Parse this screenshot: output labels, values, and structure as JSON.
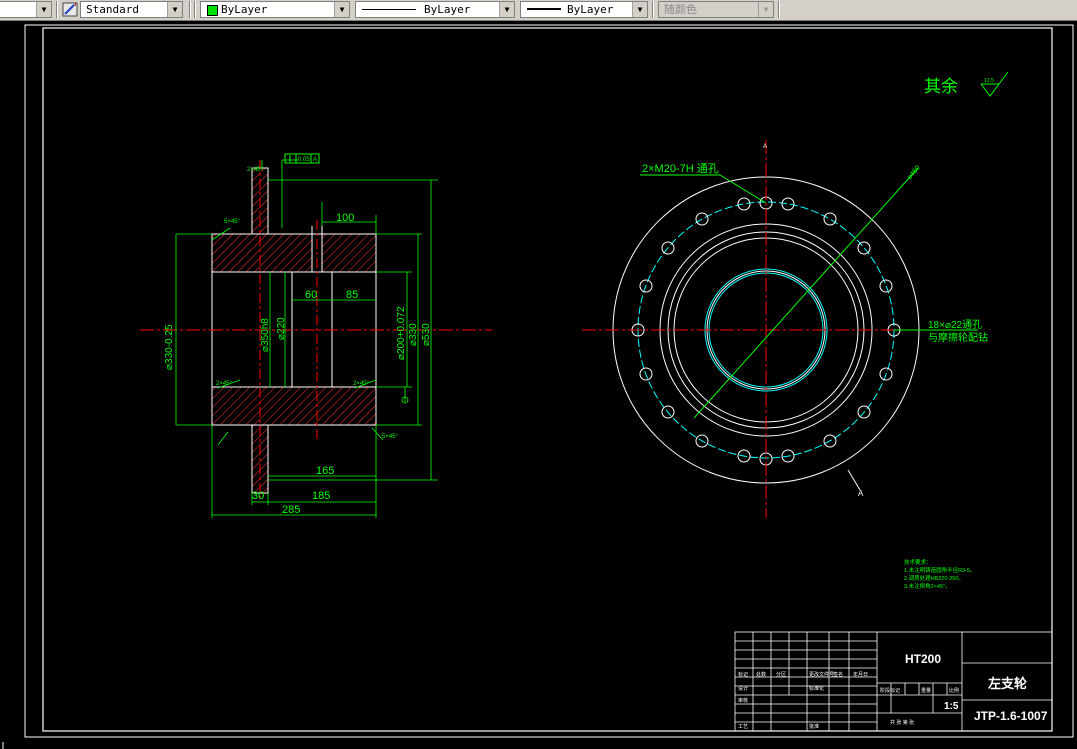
{
  "toolbar": {
    "textstyle": "Standard",
    "layer": "ByLayer",
    "linetype": "ByLayer",
    "lineweight": "ByLayer",
    "plotstyle": "随颜色"
  },
  "icons": {
    "textstyle": "text-style-icon"
  },
  "colors": {
    "background": "#000000",
    "outline": "#ffffff",
    "dimension": "#00ff00",
    "centerline": "#ff0000",
    "hidden": "#00ffff",
    "hatch": "#ff3333"
  },
  "drawing": {
    "roughness": "其余",
    "roughness_value": "12.5",
    "dims": {
      "d100": "100",
      "d60": "60",
      "d85": "85",
      "d165": "165",
      "d185": "185",
      "d30": "30",
      "d285": "285",
      "dia330tol": "⌀330-0.25",
      "dia350": "⌀350h8",
      "dia220": "⌀220",
      "dia200": "⌀200+0.072",
      "dia330": "⌀330",
      "dia530": "⌀530",
      "dia450": "⌀450",
      "chamfer": "2×45°",
      "chamfer2": "5×45°",
      "tol_frame": "0.05",
      "datum": "A",
      "section": "A"
    },
    "callouts": {
      "thread": "2×M20-7H 通孔",
      "holes_1": "18×⌀22通孔",
      "holes_2": "与摩擦轮配钻"
    },
    "notes": {
      "title": "技术要求：",
      "line1": "1.未注明铸造圆角半径R3-5。",
      "line2": "2.调质处理HB220-250。",
      "line3": "3.未注倒角2×45°。"
    }
  },
  "titleblock": {
    "material": "HT200",
    "part_name": "左支轮",
    "drawing_no": "JTP-1.6-1007",
    "scale": "1:5",
    "labels": {
      "mark": "标记",
      "count": "处数",
      "zone": "分区",
      "change": "更改文件号",
      "sign": "签名",
      "date": "年月日",
      "design": "设计",
      "standard": "标准化",
      "check": "审核",
      "process": "工艺",
      "approve": "批准",
      "stage": "阶段标记",
      "weight": "重量",
      "scale_lbl": "比例",
      "sheets": "共 张 第 张"
    }
  }
}
